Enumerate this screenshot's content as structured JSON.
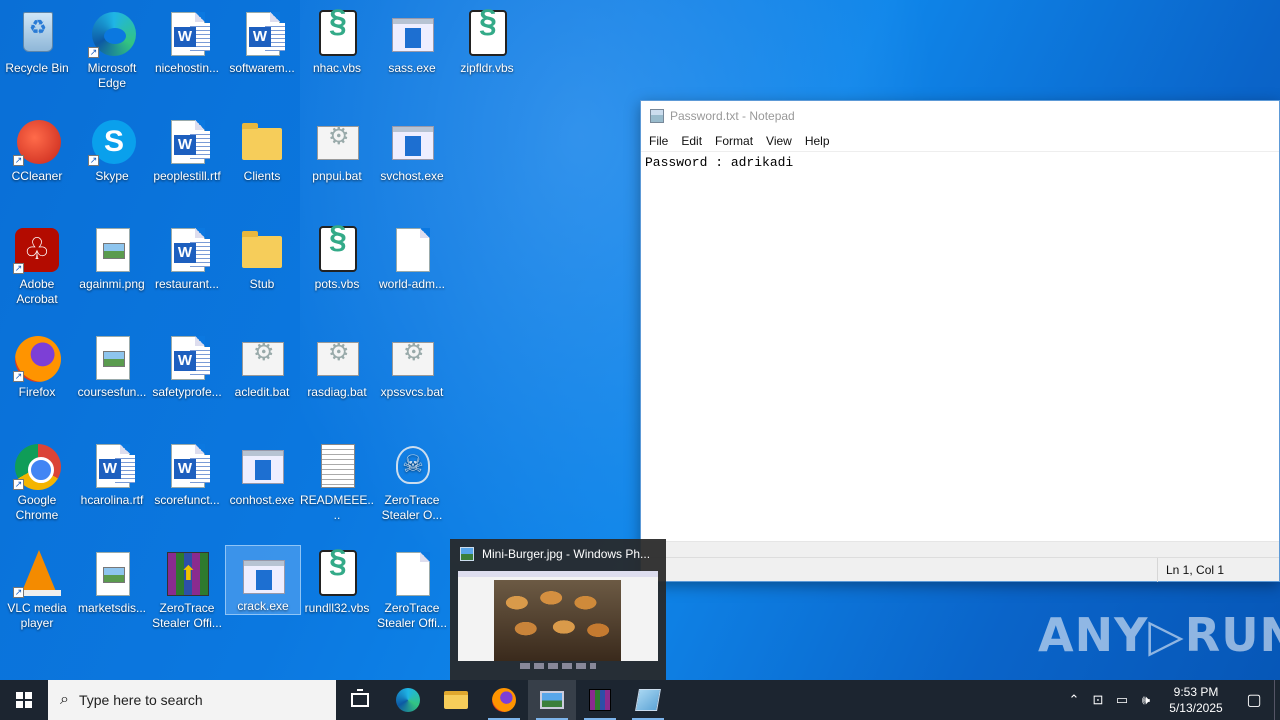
{
  "desktop": {
    "icons": [
      {
        "label": "Recycle Bin"
      },
      {
        "label": "Microsoft Edge"
      },
      {
        "label": "nicehostin..."
      },
      {
        "label": "softwarem..."
      },
      {
        "label": "nhac.vbs"
      },
      {
        "label": "sass.exe"
      },
      {
        "label": "zipfldr.vbs"
      },
      {
        "label": "CCleaner"
      },
      {
        "label": "Skype"
      },
      {
        "label": "peoplestill.rtf"
      },
      {
        "label": "Clients"
      },
      {
        "label": "pnpui.bat"
      },
      {
        "label": "svchost.exe"
      },
      {
        "label": "Adobe Acrobat"
      },
      {
        "label": "againmi.png"
      },
      {
        "label": "restaurant..."
      },
      {
        "label": "Stub"
      },
      {
        "label": "pots.vbs"
      },
      {
        "label": "world-adm..."
      },
      {
        "label": "Firefox"
      },
      {
        "label": "coursesfun..."
      },
      {
        "label": "safetyprofe..."
      },
      {
        "label": "acledit.bat"
      },
      {
        "label": "rasdiag.bat"
      },
      {
        "label": "xpssvcs.bat"
      },
      {
        "label": "Google Chrome"
      },
      {
        "label": "hcarolina.rtf"
      },
      {
        "label": "scorefunct..."
      },
      {
        "label": "conhost.exe"
      },
      {
        "label": "READMEEE...."
      },
      {
        "label": "ZeroTrace Stealer O..."
      },
      {
        "label": "VLC media player"
      },
      {
        "label": "marketsdis..."
      },
      {
        "label": "ZeroTrace Stealer Offi..."
      },
      {
        "label": "crack.exe"
      },
      {
        "label": "rundll32.vbs"
      },
      {
        "label": "ZeroTrace Stealer Offi..."
      }
    ]
  },
  "notepad": {
    "title": "Password.txt - Notepad",
    "menu": [
      "File",
      "Edit",
      "Format",
      "View",
      "Help"
    ],
    "content": "Password : adrikadi",
    "status_position": "Ln 1, Col 1"
  },
  "thumbnail": {
    "title": "Mini-Burger.jpg - Windows Ph..."
  },
  "watermark": "ANY▷RUN",
  "taskbar": {
    "search_placeholder": "Type here to search",
    "time": "9:53 PM",
    "date": "5/13/2025"
  },
  "colors": {
    "desktop_bg": "#0b78e0",
    "taskbar_bg": "#1c2530",
    "selection": "#96c8ff"
  }
}
